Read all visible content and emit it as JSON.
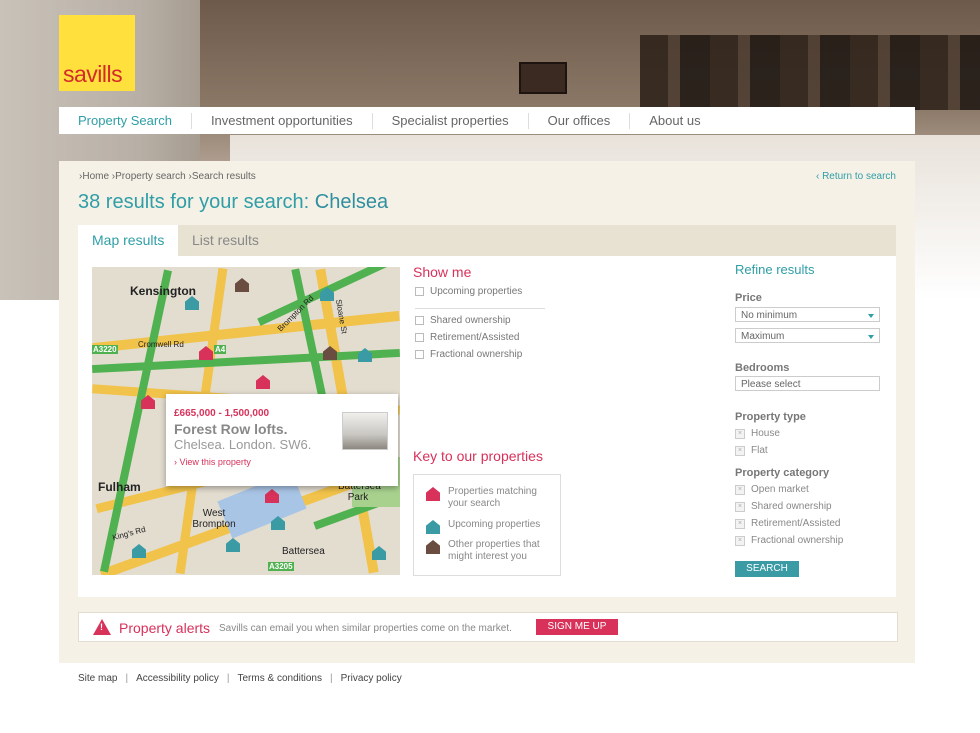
{
  "logo": {
    "text": "savills"
  },
  "nav": [
    "Property Search",
    "Investment opportunities",
    "Specialist properties",
    "Our offices",
    "About us"
  ],
  "breadcrumb": [
    "Home",
    "Property search",
    "Search results"
  ],
  "return_link": "Return to search",
  "results_heading": {
    "prefix": "38 results for your search:",
    "location": "Chelsea"
  },
  "tabs": [
    "Map results",
    "List results"
  ],
  "map": {
    "labels": [
      "Kensington",
      "Fulham",
      "West Brompton",
      "Battersea",
      "Battersea Park"
    ],
    "road_labels": [
      "Cromwell Rd",
      "Brompton Rd",
      "Sloane St",
      "King's Rd",
      "A3220",
      "A4",
      "A3205"
    ],
    "popup": {
      "price": "£665,000 - 1,500,000",
      "name": "Forest Row lofts.",
      "address": "Chelsea. London. SW6.",
      "view": "View this property"
    }
  },
  "show_me": {
    "title": "Show me",
    "options": [
      "Upcoming properties",
      "Shared ownership",
      "Retirement/Assisted",
      "Fractional ownership"
    ]
  },
  "key": {
    "title": "Key to our properties",
    "items": [
      "Properties matching your search",
      "Upcoming properties",
      "Other properties that might interest you"
    ]
  },
  "refine": {
    "title": "Refine results",
    "price_label": "Price",
    "price_min": "No minimum",
    "price_max": "Maximum",
    "bedrooms_label": "Bedrooms",
    "bedrooms_placeholder": "Please select",
    "type_label": "Property type",
    "types": [
      "House",
      "Flat"
    ],
    "category_label": "Property category",
    "categories": [
      "Open market",
      "Shared ownership",
      "Retirement/Assisted",
      "Fractional ownership"
    ],
    "search_button": "SEARCH"
  },
  "alerts": {
    "title": "Property alerts",
    "text": "Savills can email you when similar properties come on the market.",
    "button": "SIGN ME UP"
  },
  "footer": [
    "Site map",
    "Accessibility policy",
    "Terms & conditions",
    "Privacy policy"
  ],
  "colors": {
    "teal": "#2f9ea7",
    "pink": "#d8315a",
    "brown": "#6b4c40",
    "logo_yellow": "#ffe03c"
  }
}
